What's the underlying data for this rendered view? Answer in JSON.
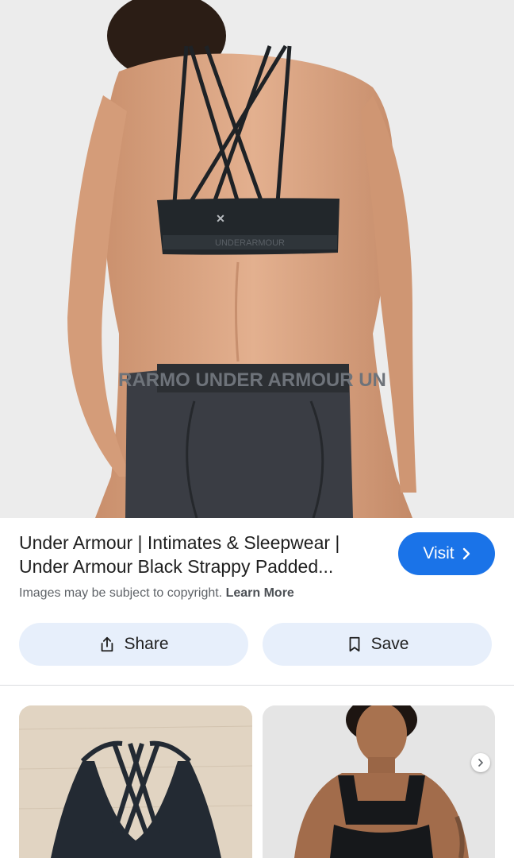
{
  "result": {
    "title": "Under Armour | Intimates & Sleepwear | Under Armour Black Strappy Padded...",
    "copyright_text": "Images may be subject to copyright.",
    "learn_more_label": "Learn More",
    "visit_label": "Visit"
  },
  "actions": {
    "share_label": "Share",
    "save_label": "Save"
  },
  "image_text": {
    "waistband_text": "RARMO UNDER ARMOUR UN",
    "bra_band_text": "UNDERARMOUR"
  },
  "icons": {
    "visit": "chevron-right-icon",
    "share": "share-icon",
    "save": "bookmark-icon",
    "next": "chevron-right-icon"
  },
  "colors": {
    "accent": "#1a73e8",
    "pill_background": "#e7effb",
    "secondary_text": "#5f6368"
  }
}
